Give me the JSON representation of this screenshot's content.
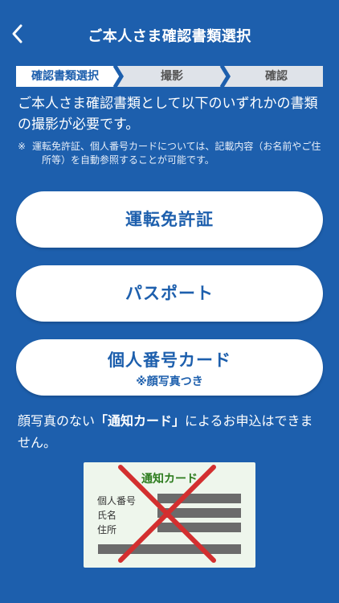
{
  "header": {
    "title": "ご本人さま確認書類選択",
    "back_icon": "chevron-left-icon"
  },
  "steps": [
    {
      "label": "確認書類選択",
      "state": "active"
    },
    {
      "label": "撮影",
      "state": "inactive"
    },
    {
      "label": "確認",
      "state": "inactive"
    }
  ],
  "intro": {
    "text": "ご本人さま確認書類として以下のいずれかの書類の撮影が必要です。",
    "note_mark": "※",
    "note_line1": "運転免許証、個人番号カードについては、記載内容（お名前やご住",
    "note_line2": "所等）を自動参照することが可能です。"
  },
  "documents": [
    {
      "label": "運転免許証",
      "sub": ""
    },
    {
      "label": "パスポート",
      "sub": ""
    },
    {
      "label": "個人番号カード",
      "sub": "※顔写真つき"
    }
  ],
  "warning": {
    "before": "顔写真のない",
    "emphasis": "「通知カード」",
    "after": "によるお申込はできません。"
  },
  "card_illustration": {
    "title": "通知カード",
    "labels": [
      "個人番号",
      "氏名",
      "住所"
    ],
    "cross_color": "#d32f2f"
  },
  "colors": {
    "background": "#1d5fad",
    "accent": "#1d5fad",
    "card_title": "#2d7c1e"
  }
}
